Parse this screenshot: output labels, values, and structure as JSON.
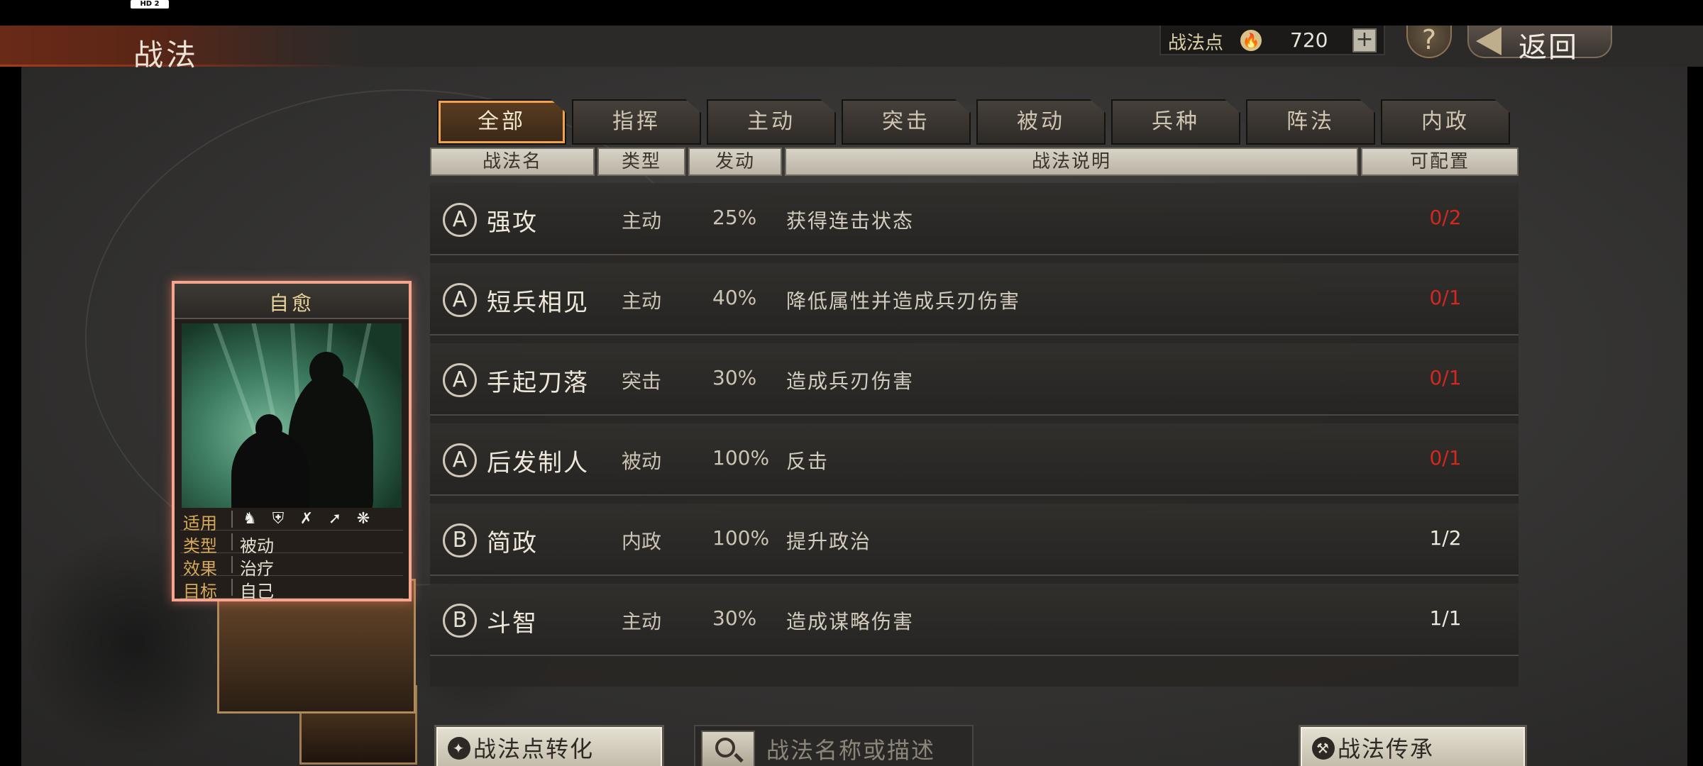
{
  "status_bar": {
    "badge": "HD 2"
  },
  "header": {
    "title": "战法",
    "points_label": "战法点",
    "points_value": "720",
    "plus_label": "+",
    "help_label": "?",
    "back_label": "返回"
  },
  "tabs": [
    "全部",
    "指挥",
    "主动",
    "突击",
    "被动",
    "兵种",
    "阵法",
    "内政"
  ],
  "active_tab": 0,
  "columns": [
    "战法名",
    "类型",
    "发动",
    "战法说明",
    "可配置"
  ],
  "rows": [
    {
      "grade": "A",
      "name": "强攻",
      "type": "主动",
      "rate": "25%",
      "desc": "获得连击状态",
      "count": "0/2",
      "count_color": "#d2281e"
    },
    {
      "grade": "A",
      "name": "短兵相见",
      "type": "主动",
      "rate": "40%",
      "desc": "降低属性并造成兵刃伤害",
      "count": "0/1",
      "count_color": "#d2281e"
    },
    {
      "grade": "A",
      "name": "手起刀落",
      "type": "突击",
      "rate": "30%",
      "desc": "造成兵刃伤害",
      "count": "0/1",
      "count_color": "#d2281e"
    },
    {
      "grade": "A",
      "name": "后发制人",
      "type": "被动",
      "rate": "100%",
      "desc": "反击",
      "count": "0/1",
      "count_color": "#d2281e"
    },
    {
      "grade": "B",
      "name": "简政",
      "type": "内政",
      "rate": "100%",
      "desc": "提升政治",
      "count": "1/2",
      "count_color": "#eeeae0"
    },
    {
      "grade": "B",
      "name": "斗智",
      "type": "主动",
      "rate": "30%",
      "desc": "造成谋略伤害",
      "count": "1/1",
      "count_color": "#eeeae0"
    }
  ],
  "card": {
    "title": "自愈",
    "apply_label": "适用",
    "unit_icons": [
      "cavalry-icon",
      "shield-icon",
      "bow-icon",
      "spear-icon",
      "wheel-icon"
    ],
    "type_label": "类型",
    "type_value": "被动",
    "effect_label": "效果",
    "effect_value": "治疗",
    "target_label": "目标",
    "target_value": "自己"
  },
  "bottom": {
    "convert_label": "战法点转化",
    "search_placeholder": "战法名称或描述",
    "inherit_label": "战法传承"
  },
  "colors": {
    "accent": "#f0a24e",
    "warning": "#d2281e",
    "card_border": "#f6a58e"
  }
}
